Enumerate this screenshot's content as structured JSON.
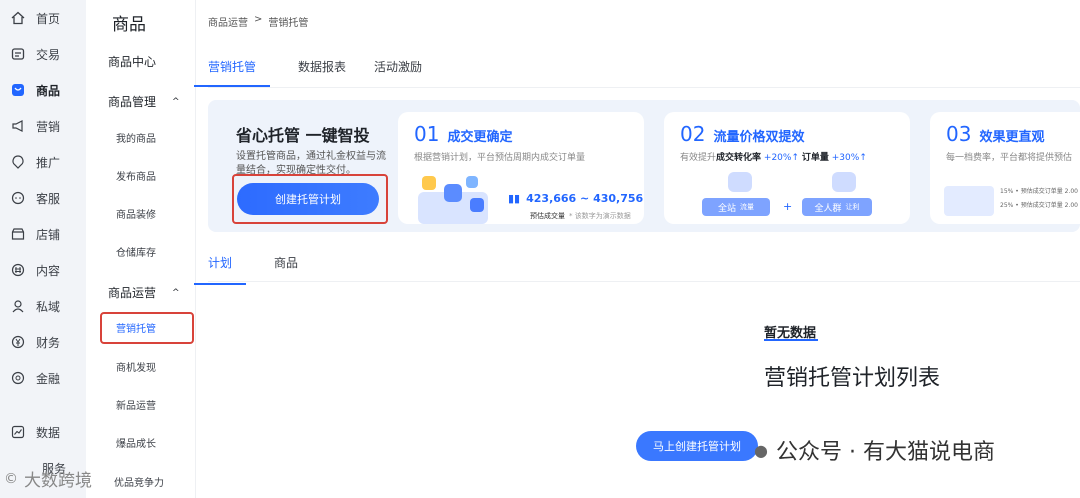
{
  "rail": {
    "items": [
      {
        "label": "首页",
        "icon": "home-icon"
      },
      {
        "label": "交易",
        "icon": "trade-icon"
      },
      {
        "label": "商品",
        "icon": "goods-icon"
      },
      {
        "label": "营销",
        "icon": "megaphone-icon"
      },
      {
        "label": "推广",
        "icon": "promote-icon"
      },
      {
        "label": "客服",
        "icon": "service-icon"
      },
      {
        "label": "店铺",
        "icon": "store-icon"
      },
      {
        "label": "内容",
        "icon": "content-icon"
      },
      {
        "label": "私域",
        "icon": "private-icon"
      },
      {
        "label": "财务",
        "icon": "finance-icon"
      },
      {
        "label": "金融",
        "icon": "money-icon"
      },
      {
        "label": "数据",
        "icon": "data-icon"
      },
      {
        "label": "服务",
        "icon": "service-market-icon"
      }
    ]
  },
  "subnav": {
    "title": "商品",
    "center": "商品中心",
    "group1": "商品管理",
    "group1_items": [
      "我的商品",
      "发布商品",
      "商品装修",
      "仓储库存"
    ],
    "group2": "商品运营",
    "group2_items": [
      "营销托管",
      "商机发现",
      "新品运营",
      "爆品成长",
      "优品竞争力"
    ]
  },
  "breadcrumb": {
    "parent": "商品运营",
    "sep": ">",
    "current": "营销托管"
  },
  "tabs": [
    "营销托管",
    "数据报表",
    "活动激励"
  ],
  "hero": {
    "title": "省心托管 一键智投",
    "desc": "设置托管商品，通过礼金权益与流量结合，实现确定性交付。",
    "button": "创建托管计划"
  },
  "cards": [
    {
      "num": "01",
      "title": "成交更确定",
      "sub": "根据营销计划，平台预估周期内成交订单量",
      "range": "423,666 ~ 430,756",
      "range_label": "预估成交量",
      "note": "* 该数字为演示数据"
    },
    {
      "num": "02",
      "title": "流量价格双提效",
      "sub_prefix": "有效提升",
      "metric1": "成交转化率",
      "val1": "+20%",
      "metric2": "订单量",
      "val2": "+30%",
      "chip1": "全站",
      "chip1b": "流量",
      "chip2": "全人群",
      "chip2b": "让利",
      "plus": "+"
    },
    {
      "num": "03",
      "title": "效果更直观",
      "sub": "每一档费率，平台都将提供预估",
      "row1": "15% • 预估成交订单量 2.00",
      "row2": "25% • 预估成交订单量 2.00"
    }
  ],
  "sub_tabs": [
    "计划",
    "商品"
  ],
  "empty": {
    "label": "暂无数据",
    "title": "营销托管计划列表",
    "button": "马上创建托管计划"
  },
  "watermark": {
    "right": "公众号 · 有大猫说电商",
    "left": "大数跨境"
  },
  "colors": {
    "accent": "#2266ff",
    "highlight_border": "#d8433a",
    "banner_bg": "#eef3fb"
  }
}
